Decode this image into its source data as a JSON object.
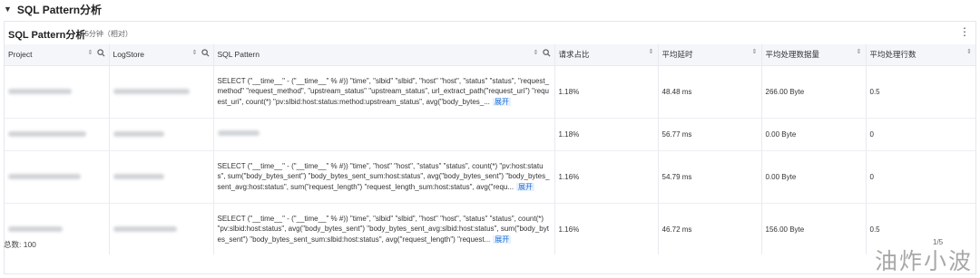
{
  "section": {
    "title": "SQL Pattern分析"
  },
  "panel": {
    "title": "SQL Pattern分析",
    "subtitle": "15分钟（相对）"
  },
  "table": {
    "columns": [
      "Project",
      "LogStore",
      "SQL Pattern",
      "请求占比",
      "平均延时",
      "平均处理数据量",
      "平均处理行数"
    ],
    "expand_label": "展开",
    "rows": [
      {
        "sql": "SELECT (\"__time__\" - (\"__time__\" % #)) \"time\", \"slbid\" \"slbid\", \"host\" \"host\", \"status\" \"status\", \"request_method\" \"request_method\", \"upstream_status\" \"upstream_status\", url_extract_path(\"request_uri\") \"request_uri\", count(*) \"pv:slbid:host:status:method:upstream_status\", avg(\"body_bytes_...",
        "ratio": "1.18%",
        "latency": "48.48 ms",
        "data": "266.00 Byte",
        "rows": "0.5"
      },
      {
        "sql": "",
        "ratio": "1.18%",
        "latency": "56.77 ms",
        "data": "0.00 Byte",
        "rows": "0"
      },
      {
        "sql": "SELECT (\"__time__\" - (\"__time__\" % #)) \"time\", \"host\" \"host\", \"status\" \"status\", count(*) \"pv:host:status\", sum(\"body_bytes_sent\") \"body_bytes_sent_sum:host:status\", avg(\"body_bytes_sent\") \"body_bytes_sent_avg:host:status\", sum(\"request_length\") \"request_length_sum:host:status\", avg(\"requ...",
        "ratio": "1.16%",
        "latency": "54.79 ms",
        "data": "0.00 Byte",
        "rows": "0"
      },
      {
        "sql": "SELECT (\"__time__\" - (\"__time__\" % #)) \"time\", \"slbid\" \"slbid\", \"host\" \"host\", \"status\" \"status\", count(*) \"pv:slbid:host:status\", avg(\"body_bytes_sent\") \"body_bytes_sent_avg:slbid:host:status\", sum(\"body_bytes_sent\") \"body_bytes_sent_sum:slbid:host:status\", avg(\"request_length\") \"request...",
        "ratio": "1.16%",
        "latency": "46.72 ms",
        "data": "156.00 Byte",
        "rows": "0.5"
      }
    ]
  },
  "footer": {
    "total": "总数: 100",
    "page": "1/5"
  },
  "watermark": "油炸小波"
}
